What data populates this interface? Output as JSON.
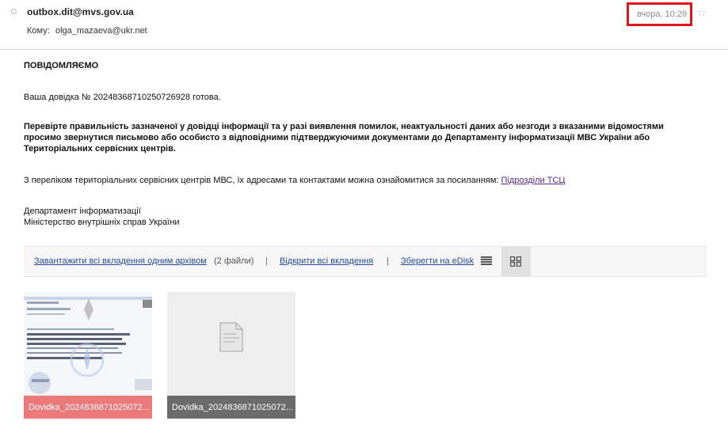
{
  "header": {
    "sender": "outbox.dit@mvs.gov.ua",
    "to_label": "Кому:",
    "to_value": "olga_mazaeva@ukr.net",
    "date": "вчора, 10:29"
  },
  "message": {
    "heading": "ПОВІДОМЛЯЄМО",
    "certificate_line": "Ваша довідка № 20248368710250726928 готова.",
    "warning_line1": "Перевірте правильність зазначеної у довідці інформації та у разі виявлення помилок, неактуальності даних або незгоди з вказаними відомостями",
    "warning_line2": "просимо звернутися письмово або особисто з відповідними підтверджуючими документами до Департаменту інформатизації МВС України або",
    "warning_line3": "Територіальних сервісних центрів.",
    "centers_text": "З переліком територіальних сервісних центрів МВС, їх адресами та контактами можна ознайомитися за посиланням:",
    "centers_link": "Підрозділи ТСЦ",
    "signature_line1": "Департамент інформатизації",
    "signature_line2": "Міністерство внутрішніх справ України"
  },
  "attachments_bar": {
    "download_all": "Завантажити всі вкладення одним архівом",
    "files_count": "(2 файли)",
    "separator": "|",
    "open_all": "Відкрити всі вкладення",
    "save_edisk": "Зберегти на eDisk",
    "list_view_icon": "list-view-icon",
    "grid_view_icon": "grid-view-icon"
  },
  "attachments": [
    {
      "name": "Dovidka_2024836871025072...",
      "kind": "document-preview",
      "caption_color": "#e96e6e"
    },
    {
      "name": "Dovidka_2024836871025072...",
      "kind": "generic-file",
      "caption_color": "#6b6b6b"
    }
  ],
  "colors": {
    "highlight": "#e0141a",
    "link": "#2a4b9b",
    "visited_link": "#5b2690"
  }
}
